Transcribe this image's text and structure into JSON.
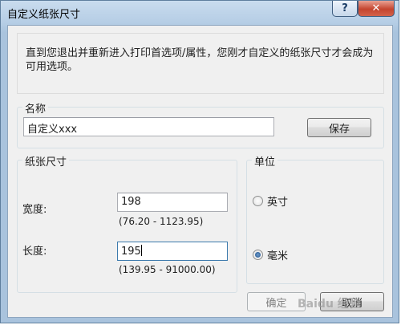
{
  "window": {
    "title": "自定义纸张尺寸",
    "help_label": "?",
    "close_label": "✕"
  },
  "info": {
    "text": "直到您退出并重新进入打印首选项/属性，您刚才自定义的纸张尺寸才会成为可用选项。"
  },
  "name_group": {
    "legend": "名称",
    "value": "自定义xxx",
    "save_label": "保存"
  },
  "size_group": {
    "legend": "纸张尺寸",
    "width_label": "宽度:",
    "width_value": "198",
    "width_range": "(76.20 - 1123.95)",
    "length_label": "长度:",
    "length_value": "195",
    "length_range": "(139.95 - 91000.00)"
  },
  "unit_group": {
    "legend": "单位",
    "options": [
      {
        "label": "英寸",
        "selected": false
      },
      {
        "label": "毫米",
        "selected": true
      }
    ]
  },
  "buttons": {
    "ok_label": "确定",
    "cancel_label": "取消"
  },
  "watermark": {
    "text": "Baidu 经验"
  }
}
